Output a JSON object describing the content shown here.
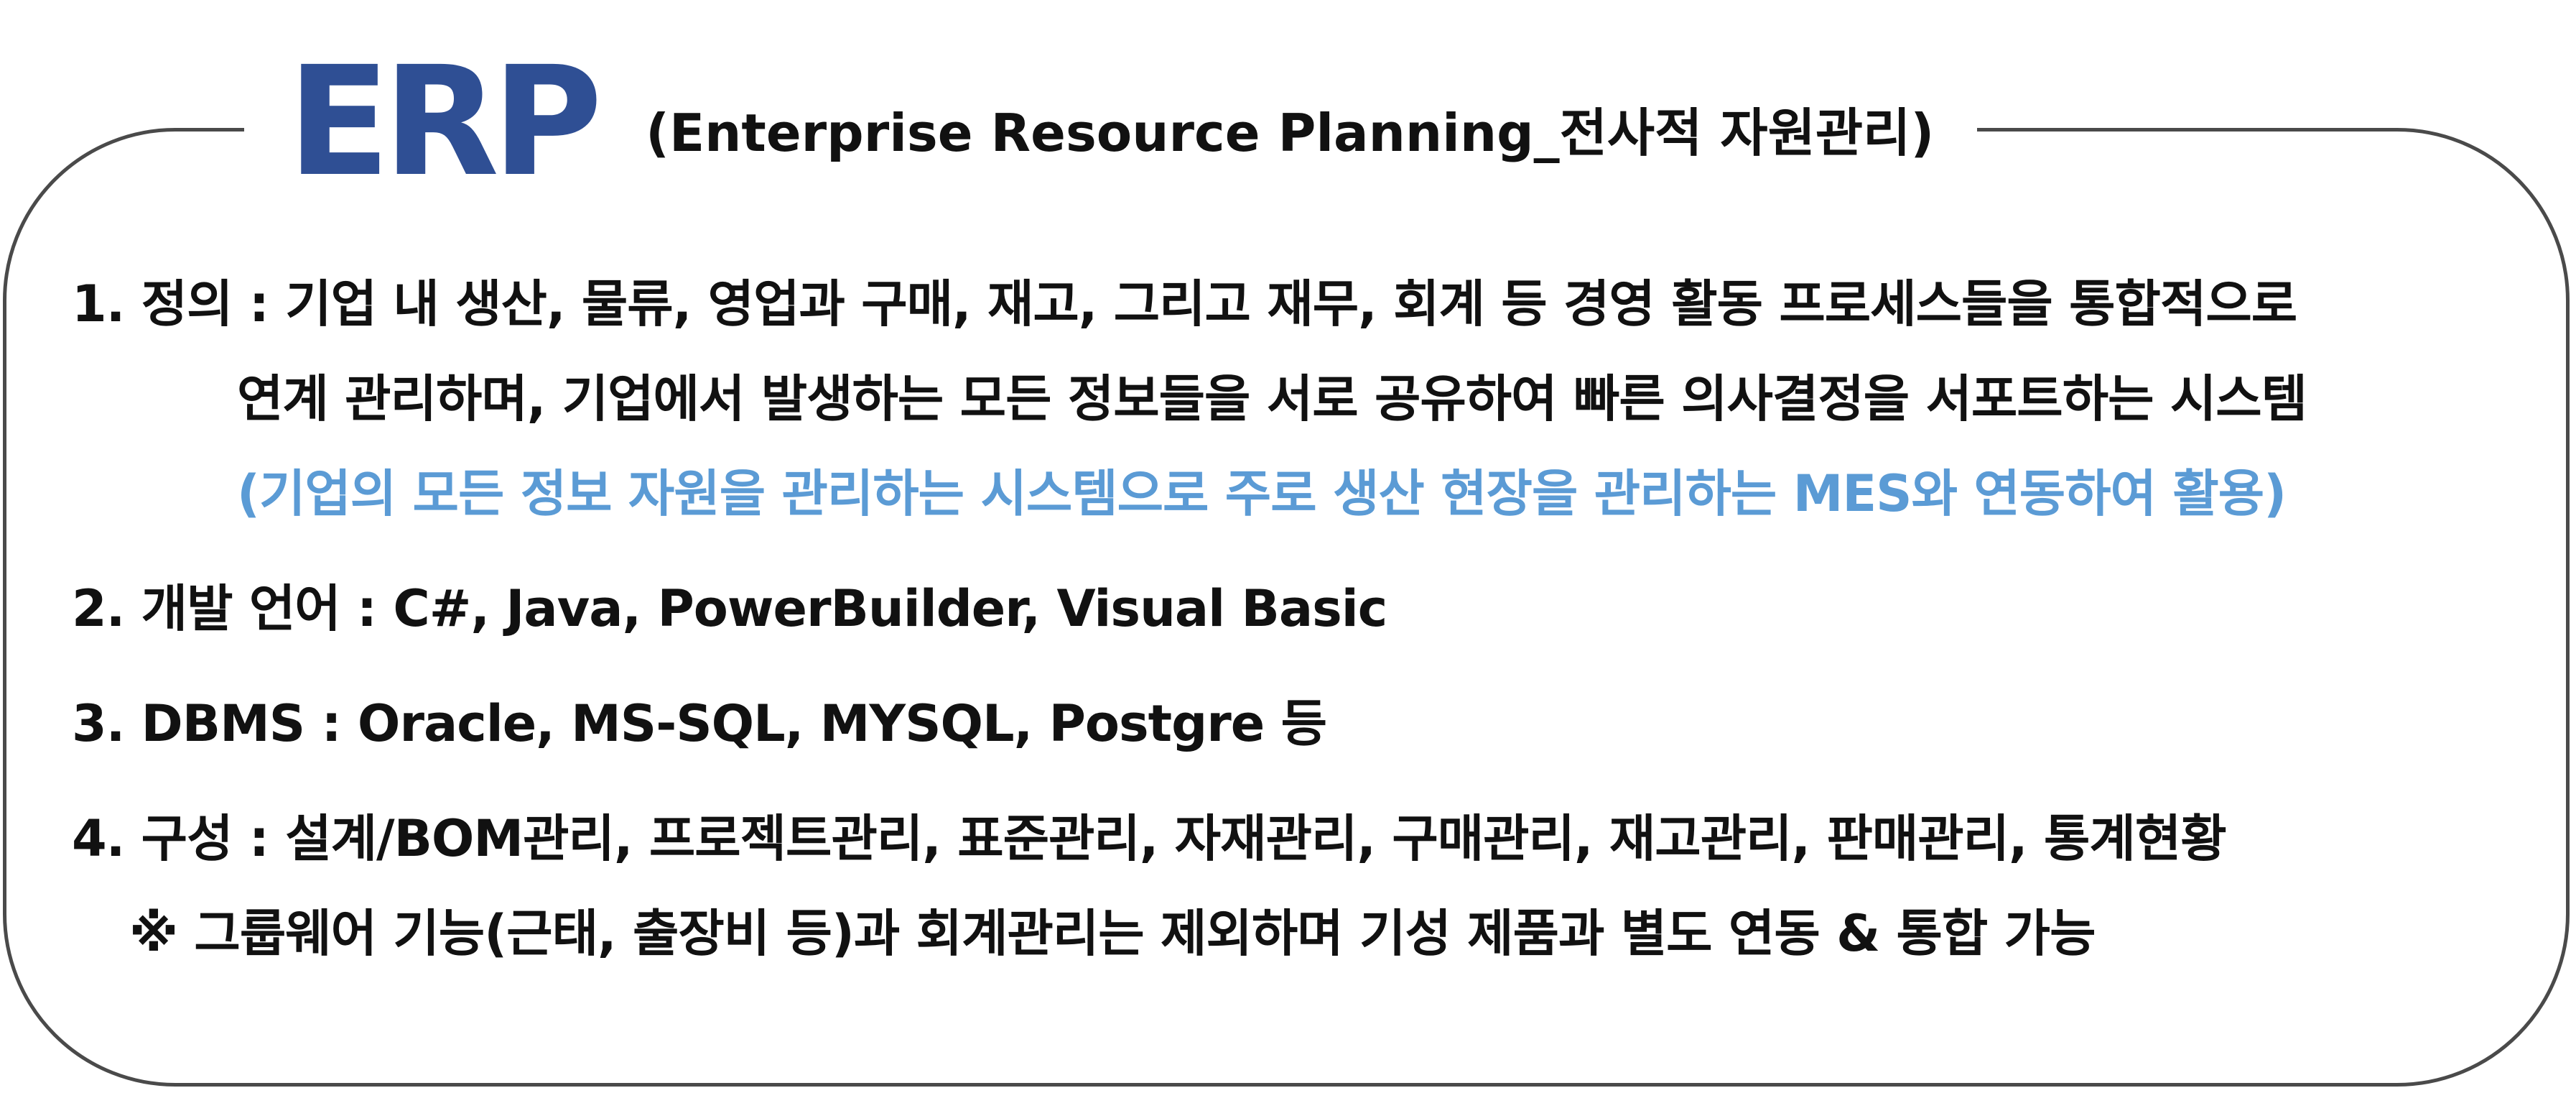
{
  "title": {
    "main": "ERP",
    "sub": "(Enterprise Resource Planning_전사적 자원관리)"
  },
  "items": [
    {
      "lines": [
        "1. 정의 : 기업 내 생산, 물류, 영업과 구매, 재고, 그리고 재무, 회계 등 경영 활동 프로세스들을 통합적으로",
        "연계 관리하며, 기업에서 발생하는 모든 정보들을 서로 공유하여 빠른 의사결정을 서포트하는 시스템"
      ],
      "note": "(기업의 모든 정보 자원을 관리하는 시스템으로 주로 생산 현장을 관리하는 MES와 연동하여 활용)"
    },
    {
      "lines": [
        "2. 개발 언어 : C#, Java, PowerBuilder, Visual Basic"
      ]
    },
    {
      "lines": [
        "3. DBMS : Oracle, MS-SQL, MYSQL, Postgre 등"
      ]
    },
    {
      "lines": [
        "4. 구성 : 설계/BOM관리, 프로젝트관리, 표준관리, 자재관리, 구매관리, 재고관리, 판매관리, 통계현황",
        "※ 그룹웨어 기능(근태, 출장비 등)과 회계관리는 제외하며 기성 제품과 별도 연동 & 통합 가능"
      ]
    }
  ],
  "colors": {
    "title": "#2f4f94",
    "note": "#5b9bd5",
    "text": "#111111",
    "border": "#4a4a4a"
  }
}
